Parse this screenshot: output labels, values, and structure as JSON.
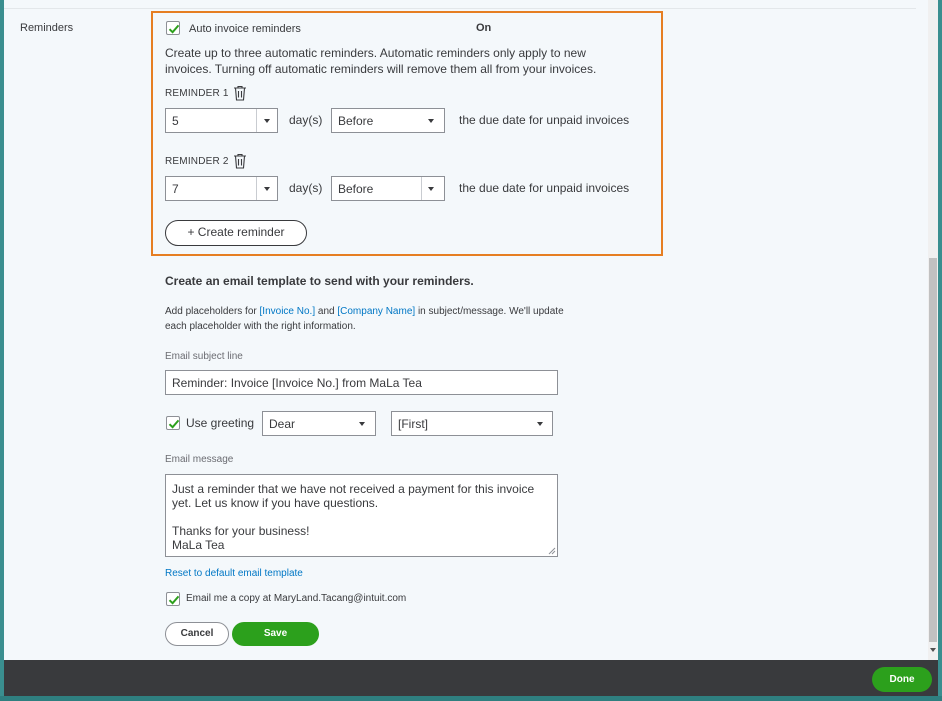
{
  "section": {
    "label": "Reminders"
  },
  "auto": {
    "label": "Auto invoice reminders",
    "status": "On",
    "checked": true
  },
  "description": {
    "line1": "Create up to three automatic reminders. Automatic reminders only apply to new",
    "line2": "invoices. Turning off automatic reminders will remove them all from your invoices."
  },
  "reminders": [
    {
      "title": "REMINDER 1",
      "days": "5",
      "days_unit": "day(s)",
      "timing": "Before",
      "suffix": "the due date for unpaid invoices"
    },
    {
      "title": "REMINDER 2",
      "days": "7",
      "days_unit": "day(s)",
      "timing": "Before",
      "suffix": "the due date for unpaid invoices"
    }
  ],
  "create_reminder_label": "+ Create reminder",
  "template": {
    "heading": "Create an email template to send with your reminders.",
    "placeholder_prefix": "Add placeholders for ",
    "placeholder_invoice": "[Invoice No.]",
    "placeholder_and": " and ",
    "placeholder_company": "[Company Name]",
    "placeholder_suffix": " in subject/message. We'll update",
    "placeholder_line2": "each placeholder with the right information.",
    "subject_label": "Email subject line",
    "subject_value": "Reminder: Invoice [Invoice No.] from MaLa Tea",
    "greeting_label": "Use greeting",
    "greeting_checked": true,
    "greeting_salutation": "Dear",
    "greeting_name": "[First]",
    "message_label": "Email message",
    "message_line1": "Just a reminder that we have not received a payment for this invoice",
    "message_line2": "yet. Let us know if you have questions.",
    "message_line3": "Thanks for your business!",
    "message_line4": "MaLa Tea",
    "reset_link": "Reset to default email template",
    "copy_label": "Email me a copy at MaryLand.Tacang@intuit.com",
    "copy_checked": true
  },
  "actions": {
    "cancel_label": "Cancel",
    "save_label": "Save",
    "done_label": "Done"
  },
  "colors": {
    "accent_green": "#2ca01c",
    "highlight_orange": "#e67e22",
    "link_blue": "#0077c5"
  }
}
